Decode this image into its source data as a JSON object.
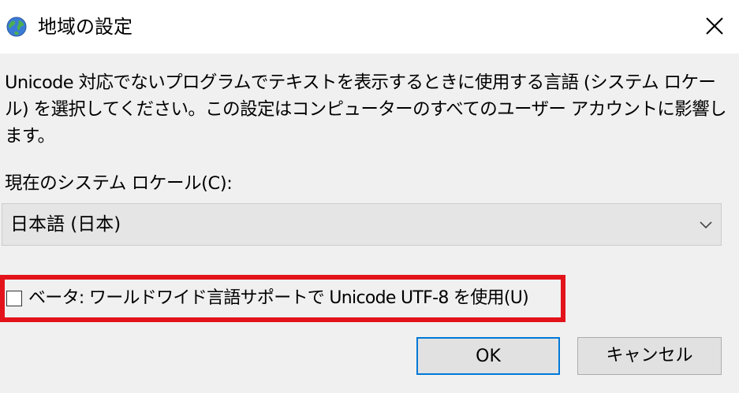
{
  "window": {
    "title": "地域の設定",
    "icon": "globe-icon",
    "close_icon": "close-icon"
  },
  "description": "Unicode 対応でないプログラムでテキストを表示するときに使用する言語 (システム ロケール) を選択してください。この設定はコンピューターのすべてのユーザー アカウントに影響します。",
  "locale": {
    "label": "現在のシステム ロケール(C):",
    "selected": "日本語 (日本)",
    "dropdown_icon": "chevron-down-icon"
  },
  "utf8_option": {
    "label": "ベータ: ワールドワイド言語サポートで Unicode UTF-8 を使用(U)",
    "checked": false
  },
  "buttons": {
    "ok": "OK",
    "cancel": "キャンセル"
  },
  "colors": {
    "highlight": "#e3131b",
    "default_button_border": "#0078d7"
  }
}
